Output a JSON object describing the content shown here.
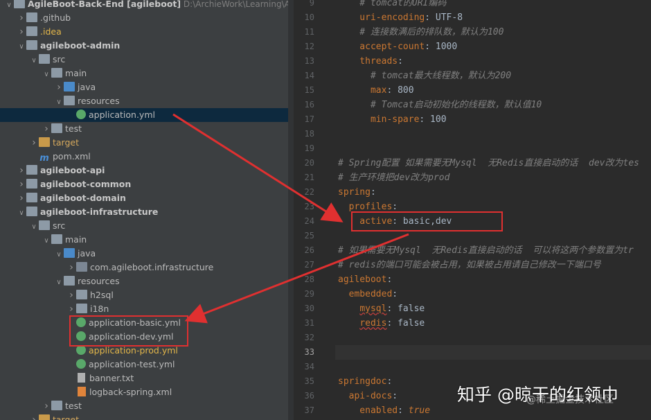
{
  "tree": {
    "rows": [
      {
        "label": "AgileBoot-Back-End [agileboot]",
        "extra": "D:\\ArchieWork\\Learning\\AgileBo",
        "indent": 0,
        "icon": "folder-icon",
        "arrow": "down",
        "style": "root"
      },
      {
        "label": ".github",
        "indent": 1,
        "icon": "folder-icon",
        "arrow": "right"
      },
      {
        "label": ".idea",
        "indent": 1,
        "icon": "folder-icon",
        "arrow": "right",
        "style": "yellow"
      },
      {
        "label": "agileboot-admin",
        "indent": 1,
        "icon": "module-icon",
        "arrow": "down",
        "style": "bold"
      },
      {
        "label": "src",
        "indent": 2,
        "icon": "folder-icon",
        "arrow": "down"
      },
      {
        "label": "main",
        "indent": 3,
        "icon": "folder-icon",
        "arrow": "down"
      },
      {
        "label": "java",
        "indent": 4,
        "icon": "source-folder-icon",
        "arrow": "right"
      },
      {
        "label": "resources",
        "indent": 4,
        "icon": "resources-folder-icon",
        "arrow": "down"
      },
      {
        "label": "application.yml",
        "indent": 5,
        "icon": "yaml-file-icon",
        "arrow": "",
        "style": "selected"
      },
      {
        "label": "test",
        "indent": 3,
        "icon": "folder-icon",
        "arrow": "right"
      },
      {
        "label": "target",
        "indent": 2,
        "icon": "excluded-folder-icon",
        "arrow": "right",
        "style": "orange"
      },
      {
        "label": "pom.xml",
        "indent": 2,
        "icon": "maven-icon",
        "arrow": ""
      },
      {
        "label": "agileboot-api",
        "indent": 1,
        "icon": "module-icon",
        "arrow": "right",
        "style": "bold"
      },
      {
        "label": "agileboot-common",
        "indent": 1,
        "icon": "module-icon",
        "arrow": "right",
        "style": "bold"
      },
      {
        "label": "agileboot-domain",
        "indent": 1,
        "icon": "module-icon",
        "arrow": "right",
        "style": "bold"
      },
      {
        "label": "agileboot-infrastructure",
        "indent": 1,
        "icon": "module-icon",
        "arrow": "down",
        "style": "bold"
      },
      {
        "label": "src",
        "indent": 2,
        "icon": "folder-icon",
        "arrow": "down"
      },
      {
        "label": "main",
        "indent": 3,
        "icon": "folder-icon",
        "arrow": "down"
      },
      {
        "label": "java",
        "indent": 4,
        "icon": "source-folder-icon",
        "arrow": "down"
      },
      {
        "label": "com.agileboot.infrastructure",
        "indent": 5,
        "icon": "package-icon",
        "arrow": "right"
      },
      {
        "label": "resources",
        "indent": 4,
        "icon": "resources-folder-icon",
        "arrow": "down"
      },
      {
        "label": "h2sql",
        "indent": 5,
        "icon": "folder-icon",
        "arrow": "right"
      },
      {
        "label": "i18n",
        "indent": 5,
        "icon": "folder-icon",
        "arrow": "right"
      },
      {
        "label": "application-basic.yml",
        "indent": 5,
        "icon": "yaml-file-icon",
        "arrow": ""
      },
      {
        "label": "application-dev.yml",
        "indent": 5,
        "icon": "yaml-file-icon",
        "arrow": ""
      },
      {
        "label": "application-prod.yml",
        "indent": 5,
        "icon": "yaml-file-icon",
        "arrow": "",
        "style": "yellow"
      },
      {
        "label": "application-test.yml",
        "indent": 5,
        "icon": "yaml-file-icon",
        "arrow": ""
      },
      {
        "label": "banner.txt",
        "indent": 5,
        "icon": "text-file-icon",
        "arrow": ""
      },
      {
        "label": "logback-spring.xml",
        "indent": 5,
        "icon": "xml-file-icon",
        "arrow": ""
      },
      {
        "label": "test",
        "indent": 3,
        "icon": "folder-icon",
        "arrow": "right"
      },
      {
        "label": "target",
        "indent": 2,
        "icon": "excluded-folder-icon",
        "arrow": "right",
        "style": "orange"
      }
    ]
  },
  "editor": {
    "current_line": "33",
    "lines": [
      {
        "num": "9",
        "segs": [
          {
            "t": "    # tomcat的URI编码",
            "c": "cm"
          }
        ]
      },
      {
        "num": "10",
        "segs": [
          {
            "t": "    uri-encoding",
            "c": "k"
          },
          {
            "t": ": UTF-8",
            "c": "v"
          }
        ]
      },
      {
        "num": "11",
        "segs": [
          {
            "t": "    # 连接数满后的排队数，默认为100",
            "c": "cm"
          }
        ]
      },
      {
        "num": "12",
        "segs": [
          {
            "t": "    accept-count",
            "c": "k"
          },
          {
            "t": ": 1000",
            "c": "v"
          }
        ]
      },
      {
        "num": "13",
        "segs": [
          {
            "t": "    threads",
            "c": "k"
          },
          {
            "t": ":",
            "c": "v"
          }
        ]
      },
      {
        "num": "14",
        "segs": [
          {
            "t": "      # tomcat最大线程数，默认为200",
            "c": "cm"
          }
        ]
      },
      {
        "num": "15",
        "segs": [
          {
            "t": "      max",
            "c": "k"
          },
          {
            "t": ": 800",
            "c": "v"
          }
        ]
      },
      {
        "num": "16",
        "segs": [
          {
            "t": "      # Tomcat启动初始化的线程数，默认值10",
            "c": "cm"
          }
        ]
      },
      {
        "num": "17",
        "segs": [
          {
            "t": "      min-spare",
            "c": "k"
          },
          {
            "t": ": 100",
            "c": "v"
          }
        ]
      },
      {
        "num": "18",
        "segs": []
      },
      {
        "num": "19",
        "segs": []
      },
      {
        "num": "20",
        "segs": [
          {
            "t": "# Spring配置 如果需要无Mysql  无Redis直接启动的话  dev改为tes",
            "c": "cm"
          }
        ]
      },
      {
        "num": "21",
        "segs": [
          {
            "t": "# 生产环境把dev改为prod",
            "c": "cm"
          }
        ]
      },
      {
        "num": "22",
        "segs": [
          {
            "t": "spring",
            "c": "k"
          },
          {
            "t": ":",
            "c": "v"
          }
        ]
      },
      {
        "num": "23",
        "segs": [
          {
            "t": "  profiles",
            "c": "k"
          },
          {
            "t": ":",
            "c": "v"
          }
        ]
      },
      {
        "num": "24",
        "segs": [
          {
            "t": "    active",
            "c": "k"
          },
          {
            "t": ": basic,dev",
            "c": "v"
          }
        ]
      },
      {
        "num": "25",
        "segs": []
      },
      {
        "num": "26",
        "segs": [
          {
            "t": "# 如果需要无Mysql  无Redis直接启动的话  可以将这两个参数置为tr",
            "c": "cm"
          }
        ]
      },
      {
        "num": "27",
        "segs": [
          {
            "t": "# redis的端口可能会被占用，如果被占用请自己修改一下端口号",
            "c": "cm"
          }
        ]
      },
      {
        "num": "28",
        "segs": [
          {
            "t": "agileboot",
            "c": "k"
          },
          {
            "t": ":",
            "c": "v"
          }
        ]
      },
      {
        "num": "29",
        "segs": [
          {
            "t": "  embedded",
            "c": "k"
          },
          {
            "t": ":",
            "c": "v"
          }
        ]
      },
      {
        "num": "30",
        "segs": [
          {
            "t": "    ",
            "c": "v"
          },
          {
            "t": "mysql",
            "c": "k u"
          },
          {
            "t": ": false",
            "c": "v"
          }
        ]
      },
      {
        "num": "31",
        "segs": [
          {
            "t": "    ",
            "c": "v"
          },
          {
            "t": "redis",
            "c": "k u"
          },
          {
            "t": ": false",
            "c": "v"
          }
        ]
      },
      {
        "num": "32",
        "segs": []
      },
      {
        "num": "33",
        "segs": []
      },
      {
        "num": "34",
        "segs": []
      },
      {
        "num": "35",
        "segs": [
          {
            "t": "springdoc",
            "c": "k"
          },
          {
            "t": ":",
            "c": "v"
          }
        ]
      },
      {
        "num": "36",
        "segs": [
          {
            "t": "  api-docs",
            "c": "k"
          },
          {
            "t": ":",
            "c": "v"
          }
        ]
      },
      {
        "num": "37",
        "segs": [
          {
            "t": "    enabled",
            "c": "k"
          },
          {
            "t": ": ",
            "c": "v"
          },
          {
            "t": "true",
            "c": "kw"
          }
        ]
      }
    ]
  },
  "watermark": {
    "main": "知乎 @晾干的红领巾",
    "sub": "@稀土掘金技术社区"
  },
  "colors": {
    "annotation": "#e03030",
    "selection": "#0d293e",
    "key": "#cc7832",
    "comment": "#808080"
  }
}
